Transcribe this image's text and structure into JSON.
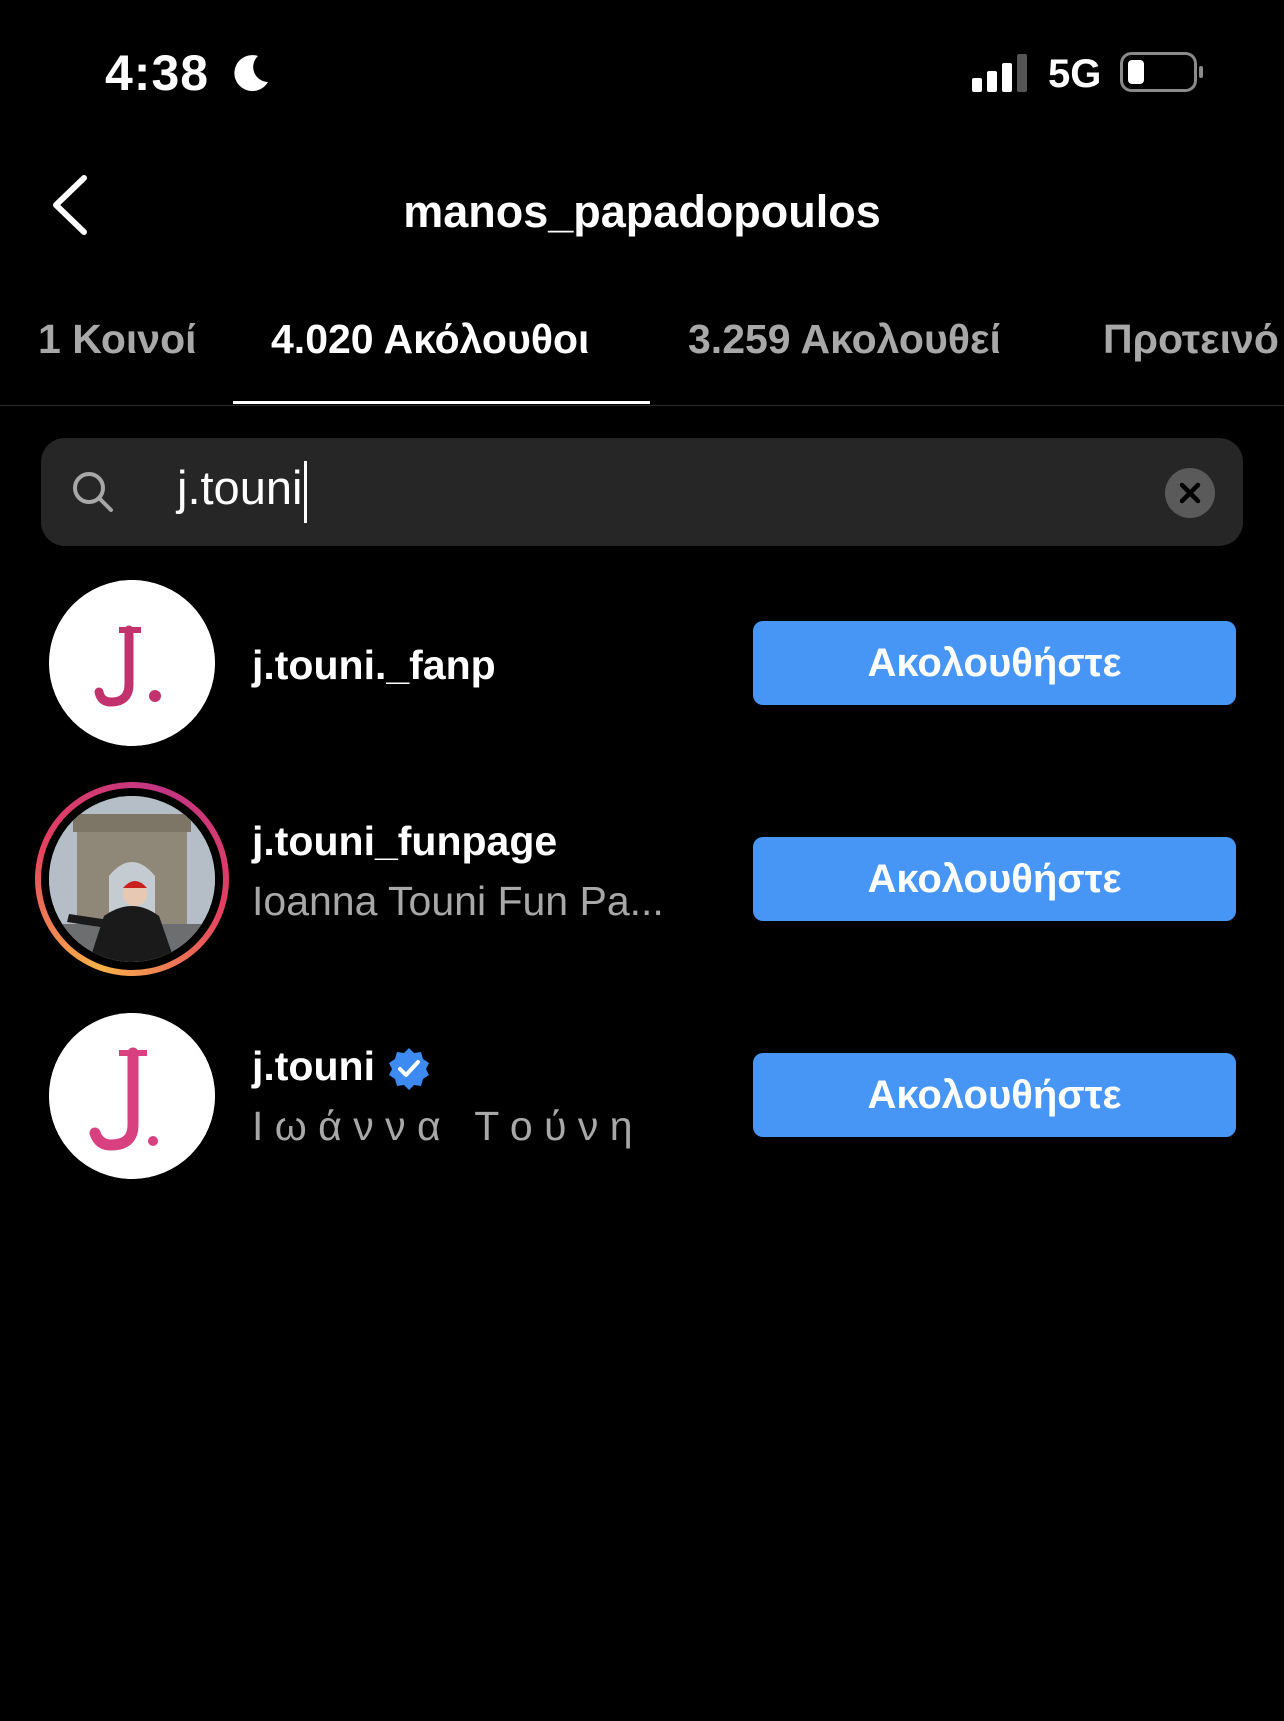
{
  "status_bar": {
    "time": "4:38",
    "network": "5G",
    "icons": [
      "moon-icon",
      "signal-icon",
      "battery-icon"
    ]
  },
  "header": {
    "title": "manos_papadopoulos",
    "back_icon": "chevron-left-icon"
  },
  "tabs": [
    {
      "label": "1 Κοινοί",
      "active": false
    },
    {
      "label": "4.020 Ακόλουθοι",
      "active": true
    },
    {
      "label": "3.259 Ακολουθεί",
      "active": false
    },
    {
      "label": "Προτεινό",
      "active": false
    }
  ],
  "search": {
    "value": "j.touni",
    "icon": "search-icon",
    "clear_icon": "close-icon"
  },
  "results": [
    {
      "username": "j.touni._fanp",
      "subtitle": "",
      "verified": false,
      "follow_label": "Ακολουθήστε",
      "avatar": "J. logo"
    },
    {
      "username": "j.touni_funpage",
      "subtitle": "Ioanna Touni Fun Pa...",
      "verified": false,
      "follow_label": "Ακολουθήστε",
      "avatar": "photo with story ring"
    },
    {
      "username": "j.touni",
      "subtitle": "Ι ω ά ν ν α   Τ ο ύ ν η",
      "verified": true,
      "follow_label": "Ακολουθήστε",
      "avatar": "J. logo"
    }
  ],
  "colors": {
    "background": "#000000",
    "follow_button": "#4796f5",
    "secondary_text": "#a8a8a8",
    "search_bg": "#262626",
    "logo_pink": "#c2336e"
  }
}
